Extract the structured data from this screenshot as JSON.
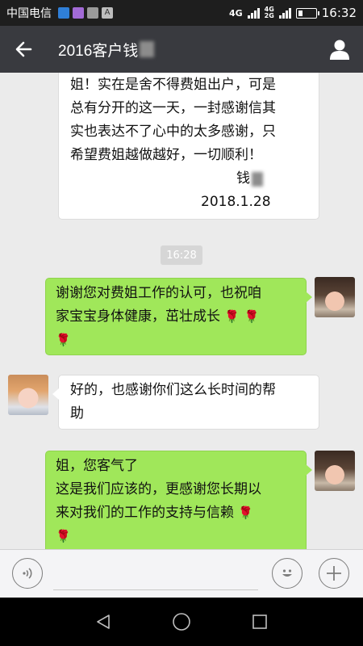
{
  "status": {
    "carrier": "中国电信",
    "network": "4G",
    "network2": "4G",
    "network3": "2G",
    "time": "16:32",
    "battery_level": 0.3
  },
  "header": {
    "title": "2016客户钱"
  },
  "messages": [
    {
      "side": "left",
      "lines": [
        "姐！实在是舍不得费姐出户，可是",
        "总有分开的这一天，一封感谢信其",
        "实也表达不了心中的太多感谢，只",
        "希望费姐越做越好，一切顺利！"
      ],
      "signature": "钱",
      "date": "2018.1.28"
    },
    {
      "timestamp": "16:28"
    },
    {
      "side": "right",
      "lines": [
        "谢谢您对费姐工作的认可，也祝咱",
        "家宝宝身体健康，茁壮成长"
      ],
      "emoji": "🌹"
    },
    {
      "side": "left",
      "lines": [
        "好的，也感谢你们这么长时间的帮",
        "助"
      ]
    },
    {
      "side": "right",
      "lines": [
        "姐，您客气了",
        "这是我们应该的，更感谢您长期以",
        "来对我们的工作的支持与信赖"
      ],
      "emoji": "🌹"
    }
  ],
  "colors": {
    "green_bubble": "#a0e75a",
    "title_bar": "#393a3f",
    "chat_bg": "#ebebeb"
  },
  "icons": {
    "back": "arrow-left-icon",
    "profile": "person-icon",
    "voice": "voice-icon",
    "emoji": "smiley-icon",
    "more": "plus-icon"
  }
}
